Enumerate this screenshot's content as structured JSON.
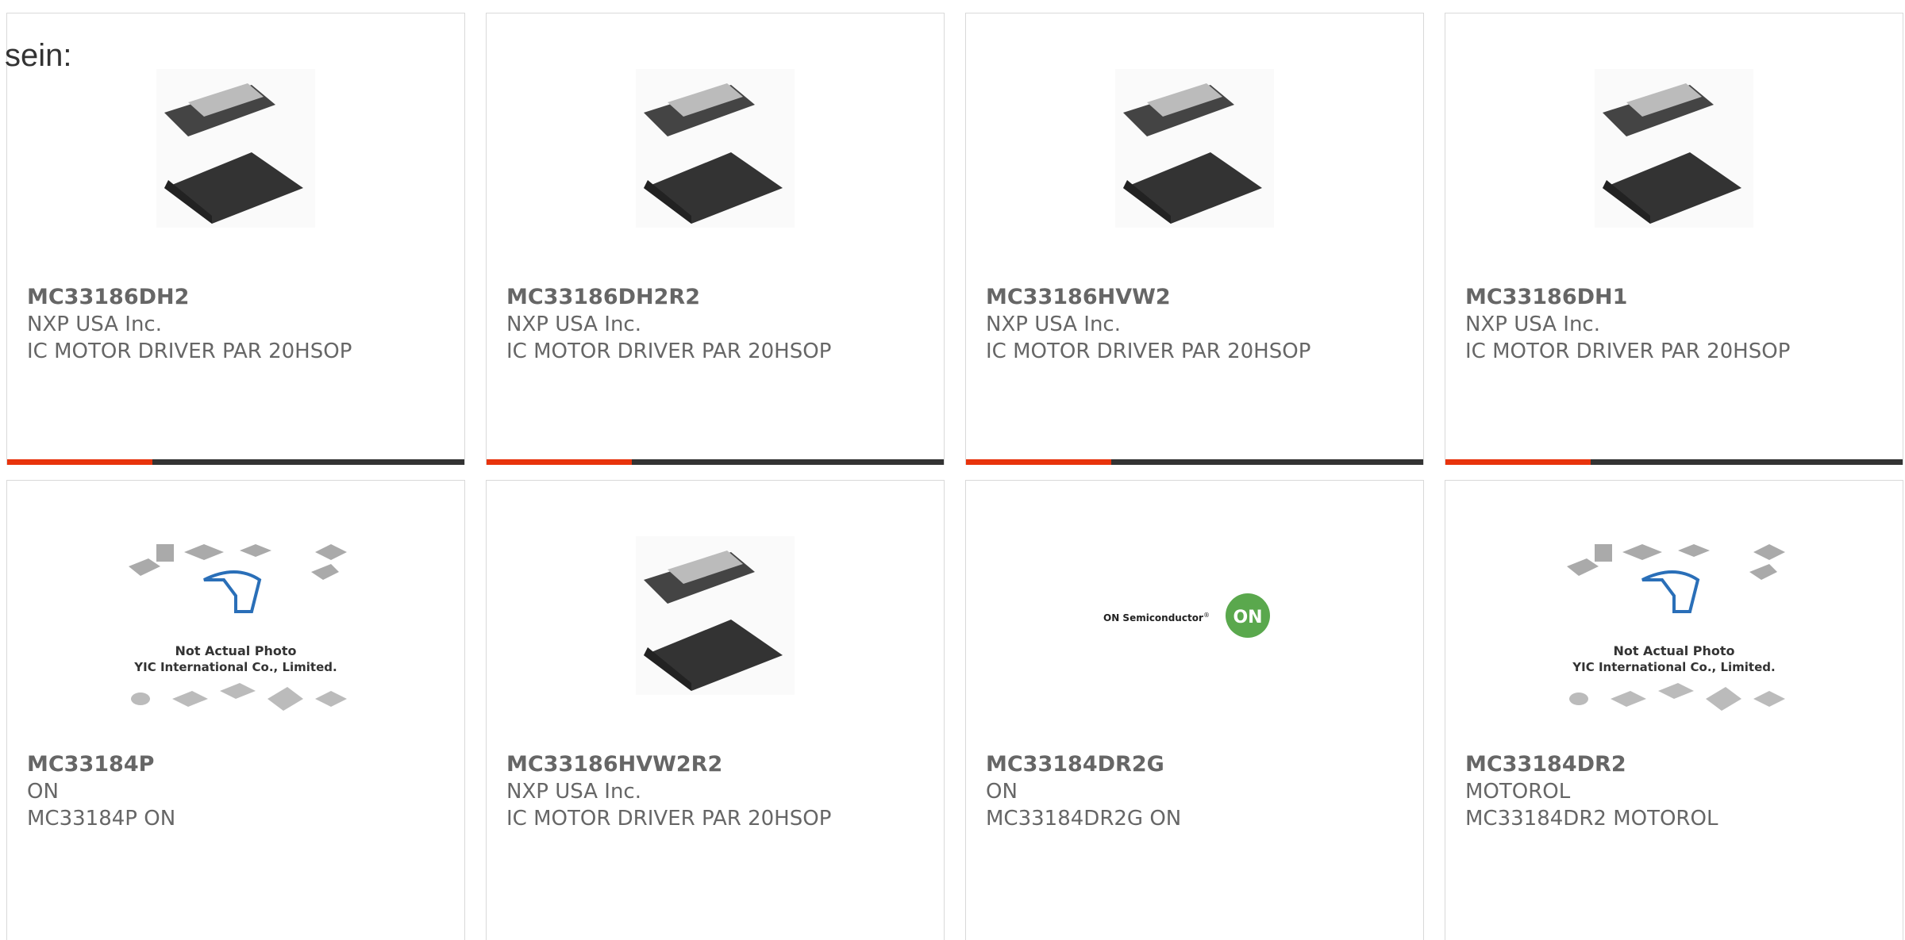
{
  "lead_text": "sein:",
  "row1": [
    {
      "part": "MC33186DH2",
      "maker": "NXP USA Inc.",
      "desc": "IC MOTOR DRIVER PAR 20HSOP"
    },
    {
      "part": "MC33186DH2R2",
      "maker": "NXP USA Inc.",
      "desc": "IC MOTOR DRIVER PAR 20HSOP"
    },
    {
      "part": "MC33186HVW2",
      "maker": "NXP USA Inc.",
      "desc": "IC MOTOR DRIVER PAR 20HSOP"
    },
    {
      "part": "MC33186DH1",
      "maker": "NXP USA Inc.",
      "desc": "IC MOTOR DRIVER PAR 20HSOP"
    }
  ],
  "row2": [
    {
      "part": "MC33184P",
      "maker": "ON",
      "desc": "MC33184P ON",
      "img": "yic"
    },
    {
      "part": "MC33186HVW2R2",
      "maker": "NXP USA Inc.",
      "desc": "IC MOTOR DRIVER PAR 20HSOP",
      "img": "chip"
    },
    {
      "part": "MC33184DR2G",
      "maker": "ON",
      "desc": "MC33184DR2G ON",
      "img": "onsemi"
    },
    {
      "part": "MC33184DR2",
      "maker": "MOTOROL",
      "desc": "MC33184DR2 MOTOROL",
      "img": "yic"
    }
  ],
  "placeholder_text": {
    "line1": "Not Actual Photo",
    "line2": "YIC International Co., Limited."
  },
  "logo_text": {
    "brand": "ON Semiconductor",
    "mark": "ON",
    "reg": "®"
  },
  "colors": {
    "accent": "#e8330c",
    "bar": "#333333",
    "border": "#d9d9d9",
    "text": "#666666"
  }
}
